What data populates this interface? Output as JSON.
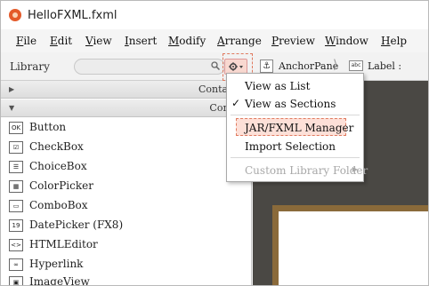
{
  "window": {
    "title": "HelloFXML.fxml"
  },
  "menu": [
    {
      "pre": "",
      "mn": "F",
      "post": "ile"
    },
    {
      "pre": "",
      "mn": "E",
      "post": "dit"
    },
    {
      "pre": "",
      "mn": "V",
      "post": "iew"
    },
    {
      "pre": "",
      "mn": "I",
      "post": "nsert"
    },
    {
      "pre": "",
      "mn": "M",
      "post": "odify"
    },
    {
      "pre": "",
      "mn": "A",
      "post": "rrange"
    },
    {
      "pre": "",
      "mn": "P",
      "post": "review"
    },
    {
      "pre": "",
      "mn": "W",
      "post": "indow"
    },
    {
      "pre": "",
      "mn": "H",
      "post": "elp"
    }
  ],
  "toolbar": {
    "library_label": "Library",
    "search_placeholder": "",
    "anchor_icon_glyph": "⚓",
    "breadcrumb_1": "AnchorPane",
    "breadcrumb_sep": "⟩",
    "abc_glyph": "abc",
    "breadcrumb_2": "Label :"
  },
  "library": {
    "sections": [
      {
        "title": "Containers",
        "triangle": "▶"
      },
      {
        "title": "Controls",
        "triangle": "▼"
      }
    ],
    "items": [
      {
        "label": "Button",
        "icon": "OK",
        "icon_name": "button-icon"
      },
      {
        "label": "CheckBox",
        "icon": "☑",
        "icon_name": "checkbox-icon"
      },
      {
        "label": "ChoiceBox",
        "icon": "☰",
        "icon_name": "choicebox-icon"
      },
      {
        "label": "ColorPicker",
        "icon": "▦",
        "icon_name": "colorpicker-icon"
      },
      {
        "label": "ComboBox",
        "icon": "▭",
        "icon_name": "combobox-icon"
      },
      {
        "label": "DatePicker  (FX8)",
        "icon": "19",
        "icon_name": "datepicker-icon"
      },
      {
        "label": "HTMLEditor",
        "icon": "<>",
        "icon_name": "htmleditor-icon"
      },
      {
        "label": "Hyperlink",
        "icon": "∞",
        "icon_name": "hyperlink-icon"
      },
      {
        "label": "ImageView",
        "icon": "▣",
        "icon_name": "imageview-icon"
      }
    ]
  },
  "dropdown": {
    "items": [
      {
        "label": "View as List",
        "checked": "",
        "disabled": false
      },
      {
        "label": "View as Sections",
        "checked": "✓",
        "disabled": false
      },
      {
        "label": "JAR/FXML Manager",
        "checked": "",
        "disabled": false
      },
      {
        "label": "Import Selection",
        "checked": "",
        "disabled": false
      },
      {
        "label": "Custom Library Folder",
        "checked": "",
        "disabled": true,
        "submenu_arrow": "▶"
      }
    ]
  },
  "colors": {
    "highlight_fill": "#fde0d8",
    "highlight_border": "#e07a5f",
    "canvas_bg": "#4a4844",
    "doc_border": "#8a6a3a"
  }
}
